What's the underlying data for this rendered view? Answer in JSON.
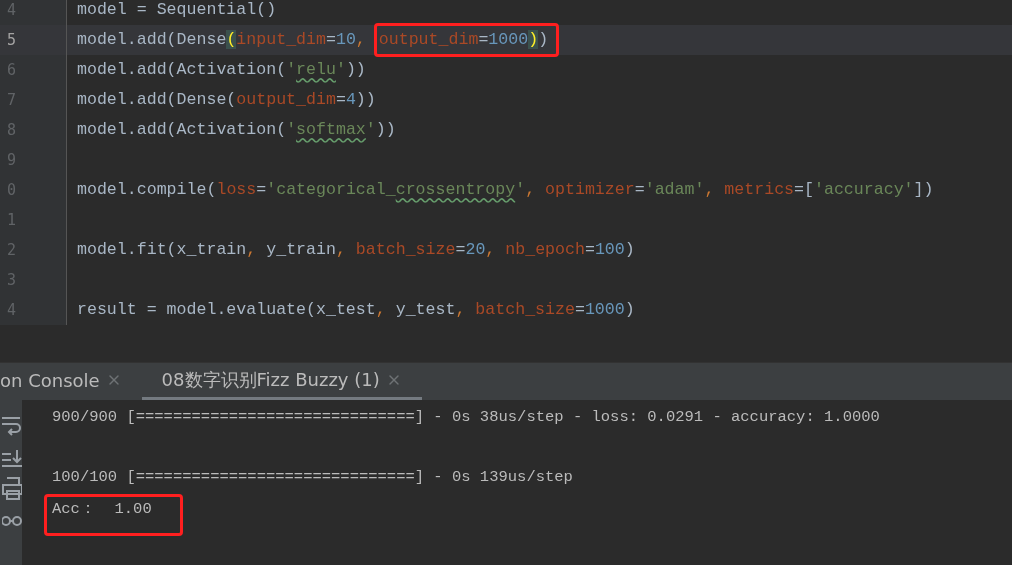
{
  "editor": {
    "lines": [
      {
        "number": "4",
        "segments": [
          {
            "tokens": [
              {
                "kind": "plain",
                "text": "model = Sequential()"
              }
            ]
          }
        ]
      },
      {
        "number": "5",
        "current": true,
        "segments": [
          {
            "tokens": [
              {
                "kind": "plain",
                "text": "model.add(Dense"
              },
              {
                "kind": "match",
                "text": "("
              },
              {
                "kind": "param",
                "text": "input_dim"
              },
              {
                "kind": "plain",
                "text": "="
              },
              {
                "kind": "number",
                "text": "10"
              },
              {
                "kind": "comma",
                "text": ", "
              }
            ]
          },
          {
            "boxed": true,
            "tokens": [
              {
                "kind": "param",
                "text": "output_dim"
              },
              {
                "kind": "plain",
                "text": "="
              },
              {
                "kind": "number",
                "text": "1000"
              },
              {
                "kind": "match",
                "text": ")"
              },
              {
                "kind": "plain",
                "text": ")"
              }
            ]
          }
        ]
      },
      {
        "number": "6",
        "segments": [
          {
            "tokens": [
              {
                "kind": "plain",
                "text": "model.add(Activation("
              },
              {
                "kind": "string",
                "text": "'"
              },
              {
                "kind": "string",
                "typo": true,
                "text": "relu"
              },
              {
                "kind": "string",
                "text": "'"
              },
              {
                "kind": "plain",
                "text": "))"
              }
            ]
          }
        ]
      },
      {
        "number": "7",
        "segments": [
          {
            "tokens": [
              {
                "kind": "plain",
                "text": "model.add(Dense("
              },
              {
                "kind": "param",
                "text": "output_dim"
              },
              {
                "kind": "plain",
                "text": "="
              },
              {
                "kind": "number",
                "text": "4"
              },
              {
                "kind": "plain",
                "text": "))"
              }
            ]
          }
        ]
      },
      {
        "number": "8",
        "segments": [
          {
            "tokens": [
              {
                "kind": "plain",
                "text": "model.add(Activation("
              },
              {
                "kind": "string",
                "text": "'"
              },
              {
                "kind": "string",
                "typo": true,
                "text": "softmax"
              },
              {
                "kind": "string",
                "text": "'"
              },
              {
                "kind": "plain",
                "text": "))"
              }
            ]
          }
        ]
      },
      {
        "number": "9"
      },
      {
        "number": "0",
        "segments": [
          {
            "tokens": [
              {
                "kind": "plain",
                "text": "model.compile("
              },
              {
                "kind": "param",
                "text": "loss"
              },
              {
                "kind": "plain",
                "text": "="
              },
              {
                "kind": "string",
                "text": "'categorical_"
              },
              {
                "kind": "string",
                "typo": true,
                "text": "crossentropy"
              },
              {
                "kind": "string",
                "text": "'"
              },
              {
                "kind": "comma",
                "text": ", "
              },
              {
                "kind": "param",
                "text": "optimizer"
              },
              {
                "kind": "plain",
                "text": "="
              },
              {
                "kind": "string",
                "text": "'adam'"
              },
              {
                "kind": "comma",
                "text": ", "
              },
              {
                "kind": "param",
                "text": "metrics"
              },
              {
                "kind": "plain",
                "text": "=["
              },
              {
                "kind": "string",
                "text": "'accuracy'"
              },
              {
                "kind": "plain",
                "text": "])"
              }
            ]
          }
        ]
      },
      {
        "number": "1"
      },
      {
        "number": "2",
        "segments": [
          {
            "tokens": [
              {
                "kind": "plain",
                "text": "model.fit(x_train"
              },
              {
                "kind": "comma",
                "text": ", "
              },
              {
                "kind": "plain",
                "text": "y_train"
              },
              {
                "kind": "comma",
                "text": ", "
              },
              {
                "kind": "param",
                "text": "batch_size"
              },
              {
                "kind": "plain",
                "text": "="
              },
              {
                "kind": "number",
                "text": "20"
              },
              {
                "kind": "comma",
                "text": ", "
              },
              {
                "kind": "param",
                "text": "nb_epoch"
              },
              {
                "kind": "plain",
                "text": "="
              },
              {
                "kind": "number",
                "text": "100"
              },
              {
                "kind": "plain",
                "text": ")"
              }
            ]
          }
        ]
      },
      {
        "number": "3"
      },
      {
        "number": "4",
        "segments": [
          {
            "tokens": [
              {
                "kind": "plain",
                "text": "result = model.evaluate(x_test"
              },
              {
                "kind": "comma",
                "text": ", "
              },
              {
                "kind": "plain",
                "text": "y_test"
              },
              {
                "kind": "comma",
                "text": ", "
              },
              {
                "kind": "param",
                "text": "batch_size"
              },
              {
                "kind": "plain",
                "text": "="
              },
              {
                "kind": "number",
                "text": "1000"
              },
              {
                "kind": "plain",
                "text": ")"
              }
            ]
          }
        ]
      }
    ]
  },
  "console": {
    "tabs": [
      {
        "label": "on Console",
        "selected": false
      },
      {
        "label": "08数字识别Fizz Buzzy (1)",
        "selected": true
      }
    ],
    "lines": [
      {
        "kind": "text",
        "text": "900/900 [==============================] - 0s 38us/step - loss: 0.0291 - accuracy: 1.0000"
      },
      {
        "kind": "blank"
      },
      {
        "kind": "text",
        "text": "100/100 [==============================] - 0s 139us/step"
      },
      {
        "kind": "text",
        "text": "Acc：  1.00",
        "boxed": true
      }
    ]
  }
}
